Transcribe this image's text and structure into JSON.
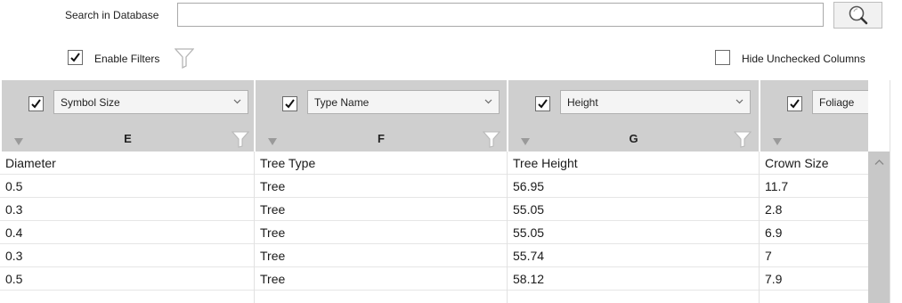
{
  "search": {
    "label": "Search in Database",
    "value": "",
    "placeholder": ""
  },
  "filters": {
    "enable_label": "Enable Filters",
    "enabled": true,
    "hide_label": "Hide Unchecked Columns",
    "hide_checked": false
  },
  "columns": [
    {
      "checked": true,
      "dropdown": "Symbol Size",
      "letter": "E",
      "header": "Diameter"
    },
    {
      "checked": true,
      "dropdown": "Type Name",
      "letter": "F",
      "header": "Tree Type"
    },
    {
      "checked": true,
      "dropdown": "Height",
      "letter": "G",
      "header": "Tree Height"
    },
    {
      "checked": true,
      "dropdown": "Foliage",
      "letter": "",
      "header": "Crown Size"
    }
  ],
  "rows": [
    [
      "0.5",
      "Tree",
      "56.95",
      "11.7"
    ],
    [
      "0.3",
      "Tree",
      "55.05",
      "2.8"
    ],
    [
      "0.4",
      "Tree",
      "55.05",
      "6.9"
    ],
    [
      "0.3",
      "Tree",
      "55.74",
      "7"
    ],
    [
      "0.5",
      "Tree",
      "58.12",
      "7.9"
    ]
  ],
  "icons": {
    "search": "magnifier-icon",
    "filter": "funnel-icon",
    "check": "checkmark-icon",
    "dropdown": "chevron-down-icon",
    "sort": "sort-triangle-icon",
    "scroll_up": "chevron-up-icon"
  },
  "colors": {
    "header_bg": "#cfcfcf",
    "scrollbar": "#c8c8c8"
  }
}
